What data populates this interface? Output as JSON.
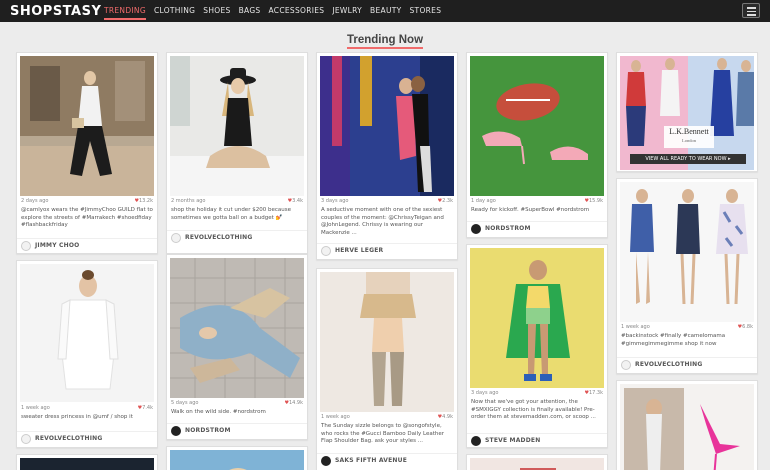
{
  "app": {
    "logo": "SHOPSTASY"
  },
  "nav": {
    "items": [
      "TRENDING",
      "CLOTHING",
      "SHOES",
      "BAGS",
      "ACCESSORIES",
      "JEWLRY",
      "BEAUTY",
      "STORES"
    ],
    "active_index": 0
  },
  "page": {
    "heading": "Trending Now"
  },
  "cards": [
    {
      "age": "2 days ago",
      "likes": "13.2k",
      "caption": "@camlyox wears the #JimmyChoo GUILD flat to explore the streets of #Marrakech #shoedfiday #flashbackfriday",
      "brand": "JIMMY CHOO"
    },
    {
      "age": "1 week ago",
      "likes": "7.4k",
      "caption": "sweater dress princess in @umf / shop it",
      "brand": "REVOLVECLOTHING"
    },
    {
      "age": "2 months ago",
      "likes": "3.4k",
      "caption": "shop the holiday it cut under $200 because sometimes we gotta ball on a budget 💅",
      "brand": "REVOLVECLOTHING"
    },
    {
      "age": "5 days ago",
      "likes": "14.9k",
      "caption": "Walk on the wild side. #nordstrom",
      "brand": "NORDSTROM"
    },
    {
      "age": "3 days ago",
      "likes": "2.3k",
      "caption": "A seductive moment with one of the sexiest couples of the moment: @ChrissyTeigan and @JohnLegend. Chrissy is wearing our Mackenzie ...",
      "brand": "HERVE LEGER"
    },
    {
      "age": "1 week ago",
      "likes": "4.9k",
      "caption": "The Sunday sizzle belongs to @songofstyle, who rocks the #Gucci Bamboo Daily Leather Flap Shoulder Bag. ask your styles ...",
      "brand": "SAKS FIFTH AVENUE"
    },
    {
      "age": "1 day ago",
      "likes": "15.9k",
      "caption": "Ready for kickoff. #SuperBowl #nordstrom",
      "brand": "NORDSTROM"
    },
    {
      "age": "3 days ago",
      "likes": "17.3k",
      "caption": "Now that we've got your attention, the #SMXIGGY collection is finally available! Pre-order them at stevemadden.com, or scoop ...",
      "brand": "STEVE MADDEN"
    },
    {
      "age": "1 week ago",
      "likes": "6.8k",
      "caption": "#backinstock #finally #camelomama #gimmegimmegimme shop it now",
      "brand": "REVOLVECLOTHING"
    }
  ],
  "ads": {
    "lk_bennett_brand": "L.K.Bennett",
    "lk_bennett_sub": "London",
    "lk_bennett_cta": "VIEW ALL READY TO WEAR NOW ▸"
  },
  "colors": {
    "accent": "#f06b6b",
    "nav_bg": "#1f1f1f",
    "page_bg": "#ececec"
  }
}
